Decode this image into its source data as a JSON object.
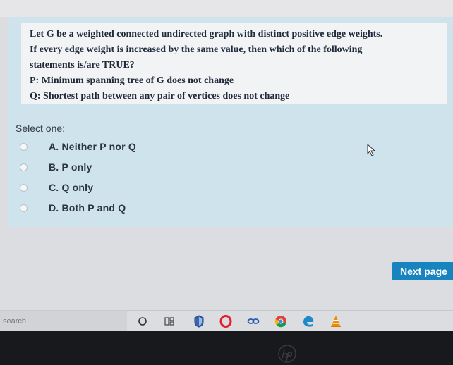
{
  "question": {
    "lines": [
      "Let G be a weighted connected undirected graph with distinct positive edge weights.",
      "If every edge weight is increased by the same value, then which of the following",
      "statements is/are TRUE?",
      "P: Minimum spanning tree of G does not change",
      "Q: Shortest path between any pair of vertices does not change"
    ]
  },
  "answer": {
    "prompt": "Select one:",
    "options": [
      {
        "label": "A. Neither P nor Q"
      },
      {
        "label": "B. P only"
      },
      {
        "label": "C. Q only"
      },
      {
        "label": "D. Both P and Q"
      }
    ]
  },
  "navigation": {
    "next_label": "Next page"
  },
  "taskbar": {
    "search_placeholder": "search",
    "icons": [
      "cortana-icon",
      "task-view-icon",
      "security-shield-icon",
      "opera-icon",
      "link-icon",
      "chrome-icon",
      "edge-icon",
      "vlc-icon"
    ]
  },
  "colors": {
    "card_background": "#cfe3ec",
    "question_background": "#f2f3f4",
    "next_button": "#1784bf"
  }
}
